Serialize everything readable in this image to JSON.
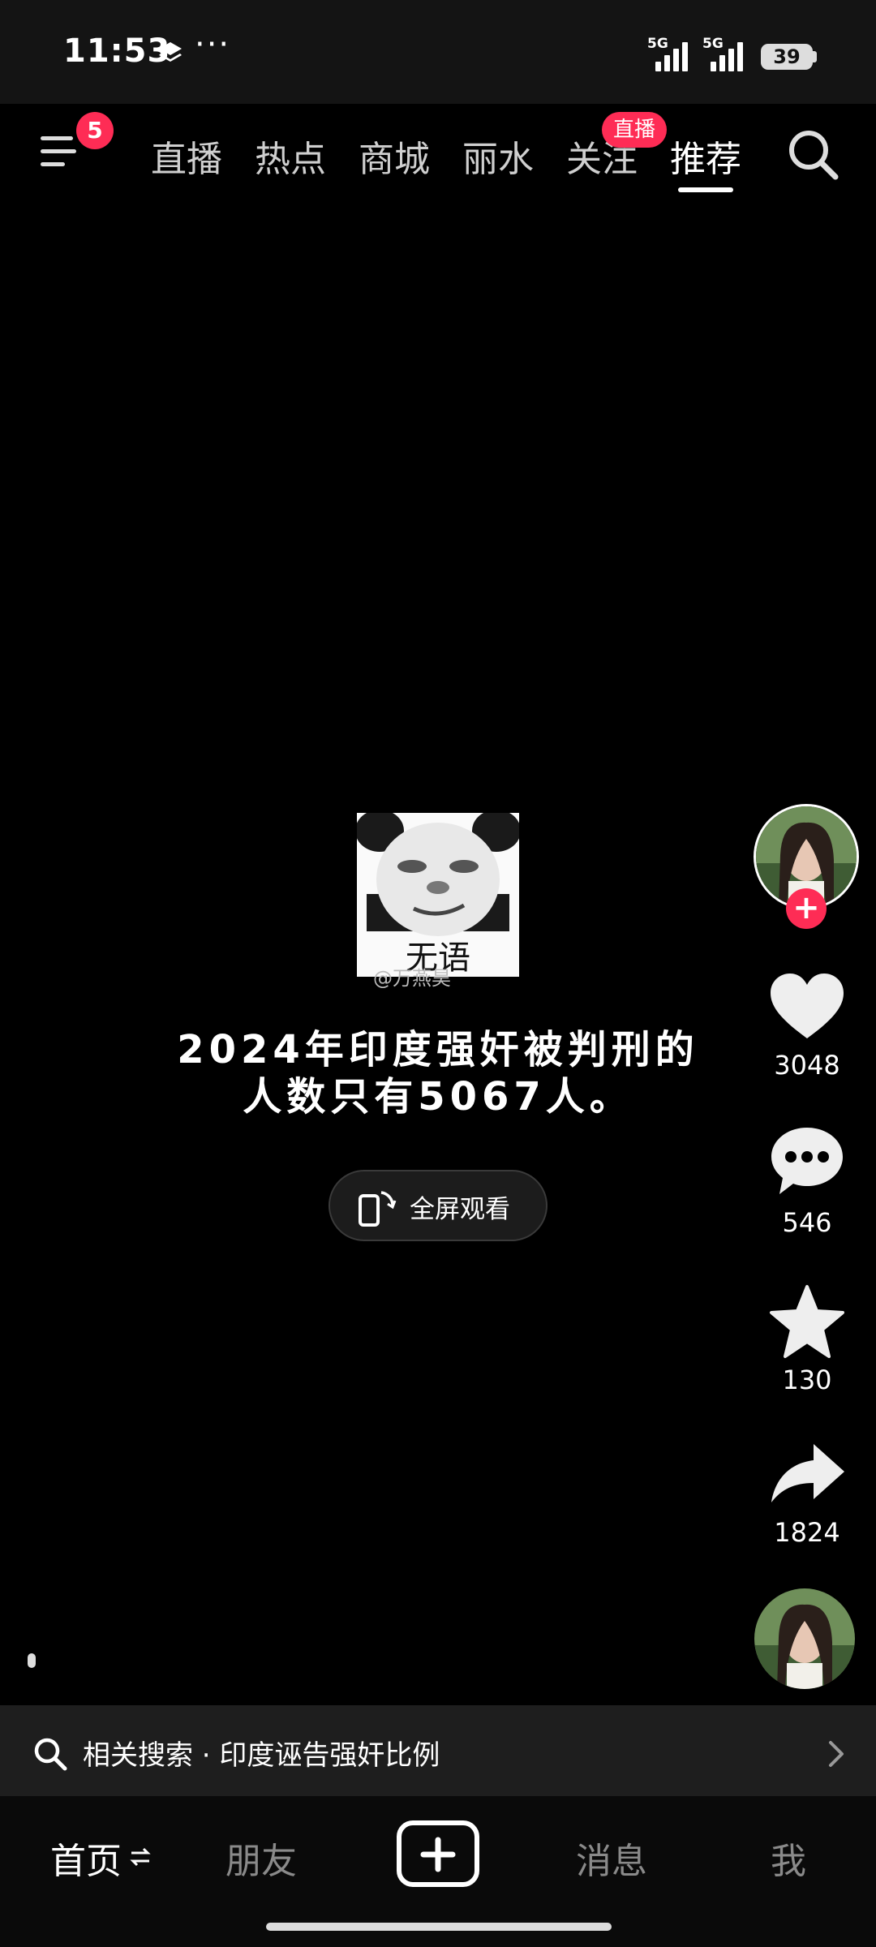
{
  "status_bar": {
    "time": "11:53",
    "more": "···",
    "signal_1_label": "5G",
    "signal_2_label": "5G",
    "battery": "39"
  },
  "top_nav": {
    "menu_badge": "5",
    "tabs": [
      "直播",
      "热点",
      "商城",
      "丽水",
      "关注",
      "推荐"
    ],
    "active_tab": "推荐",
    "follow_live_badge": "直播"
  },
  "video": {
    "meme_caption": "无语",
    "watermark": "@万燕昊",
    "headline_line1": "2024年印度强奸被判刑的",
    "headline_line2": "人数只有5067人。",
    "fullscreen_label": "全屏观看"
  },
  "actions": {
    "likes": "3048",
    "comments": "546",
    "favorites": "130",
    "shares": "1824"
  },
  "related_search": {
    "text": "相关搜索 · 印度诬告强奸比例"
  },
  "bottom_tabs": {
    "home": "首页",
    "friends": "朋友",
    "messages": "消息",
    "me": "我"
  },
  "colors": {
    "accent": "#fe2c55",
    "background": "#000000"
  }
}
